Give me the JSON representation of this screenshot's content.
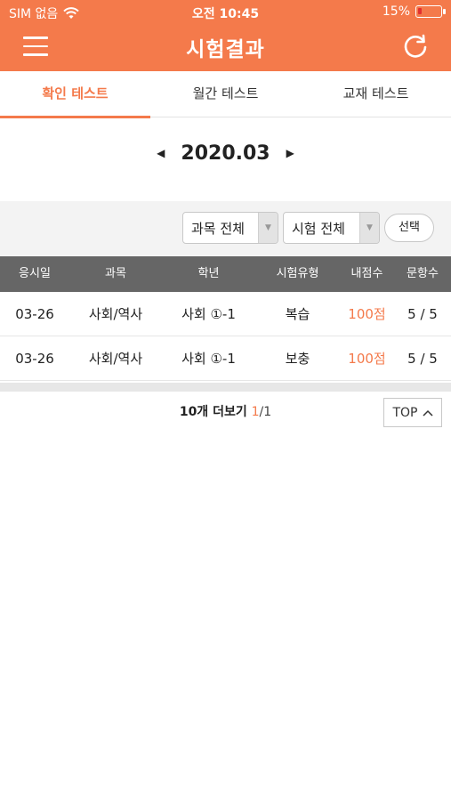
{
  "status_bar": {
    "carrier": "SIM 없음",
    "time": "오전 10:45",
    "battery": "15%",
    "battery_level": 0.15,
    "battery_color": "#e23030",
    "wifi_icon": "wifi-icon"
  },
  "header": {
    "title": "시험결과",
    "menu_icon": "hamburger-menu-icon",
    "refresh_icon": "refresh-icon",
    "accent_color": "#f47a4b"
  },
  "tabs": [
    {
      "label": "확인 테스트",
      "active": true
    },
    {
      "label": "월간 테스트",
      "active": false
    },
    {
      "label": "교재 테스트",
      "active": false
    }
  ],
  "month_nav": {
    "prev_icon": "◀",
    "label": "2020.03",
    "next_icon": "▶"
  },
  "filters": {
    "subject": "과목 전체",
    "exam": "시험 전체",
    "select_button": "선택",
    "caret_icon": "▼"
  },
  "table": {
    "headers": [
      "응시일",
      "과목",
      "학년",
      "시험유형",
      "내점수",
      "문항수"
    ],
    "rows": [
      {
        "date": "03-26",
        "subject": "사회/역사",
        "grade": "사회 ①-1",
        "type": "복습",
        "score": "100점",
        "count": "5 / 5"
      },
      {
        "date": "03-26",
        "subject": "사회/역사",
        "grade": "사회 ①-1",
        "type": "보충",
        "score": "100점",
        "count": "5 / 5"
      }
    ]
  },
  "pagination": {
    "more_label": "10개 더보기",
    "current": "1",
    "separator": "/",
    "total": "1"
  },
  "top_button": {
    "label": "TOP",
    "icon": "^"
  }
}
